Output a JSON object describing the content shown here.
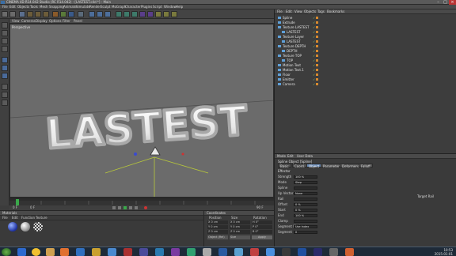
{
  "window": {
    "title": "CINEMA 4D R14.042 Studio (RC R14.042) - [LASTEST.c4d *] - Main",
    "controls": [
      "–",
      "□",
      "×"
    ]
  },
  "menubar": [
    "File",
    "Edit",
    "Objects",
    "Tools",
    "Mesh",
    "Snapping",
    "Animate",
    "Simulate",
    "Render",
    "Sculpt",
    "MoGraph",
    "Character",
    "Plugins",
    "Script",
    "Window",
    "Help"
  ],
  "viewport": {
    "menu": [
      "View",
      "Cameras",
      "Display",
      "Options",
      "Filter",
      "Panel"
    ],
    "label": "Perspective",
    "text3d": "LASTEST"
  },
  "objects": {
    "menu": [
      "File",
      "Edit",
      "View",
      "Objects",
      "Tags",
      "Bookmarks"
    ],
    "rows": [
      {
        "name": "Spline",
        "indent": 0
      },
      {
        "name": "Extrude",
        "indent": 0
      },
      {
        "name": "Texture LASTEST",
        "indent": 0
      },
      {
        "name": "LASTEST",
        "indent": 1
      },
      {
        "name": "Texture Layer",
        "indent": 0
      },
      {
        "name": "LASTEST",
        "indent": 1
      },
      {
        "name": "Texture DEPTH",
        "indent": 0
      },
      {
        "name": "DEPTH",
        "indent": 1
      },
      {
        "name": "Texture TOP",
        "indent": 0
      },
      {
        "name": "TOP",
        "indent": 1
      },
      {
        "name": "Motion Text",
        "indent": 0
      },
      {
        "name": "Motion Text.1",
        "indent": 0
      },
      {
        "name": "Floor",
        "indent": 0
      },
      {
        "name": "Emitter",
        "indent": 0
      },
      {
        "name": "Camera",
        "indent": 0
      }
    ]
  },
  "attributes": {
    "menu": [
      "Mode",
      "Edit",
      "User Data"
    ],
    "object_title": "Spline Object [Spline]",
    "tabs": [
      "Basic",
      "Coord.",
      "Object",
      "Parameter",
      "Deformers",
      "Falloff"
    ],
    "active_tab": "Object",
    "section": "Effector",
    "rows": [
      {
        "key": "Strength",
        "value": "100 %"
      },
      {
        "key": "Mode",
        "value": "Step"
      },
      {
        "key": "Spline",
        "value": ""
      },
      {
        "key": "Up Vector",
        "value": "None"
      },
      {
        "key": "Rail",
        "value": ""
      },
      {
        "key": "Offset",
        "value": "0 %"
      },
      {
        "key": "Start",
        "value": "0 %"
      },
      {
        "key": "End",
        "value": "100 %"
      },
      {
        "key": "Clamp",
        "value": ""
      },
      {
        "key": "Segment Mode",
        "value": "Use Index"
      },
      {
        "key": "Segment",
        "value": "0"
      }
    ],
    "target_rail_label": "Target Rail"
  },
  "materials": {
    "menu": [
      "File",
      "Edit",
      "Function",
      "Texture"
    ],
    "tab": "Materials",
    "swatches": [
      "blue",
      "gray",
      "checker"
    ]
  },
  "coordinates": {
    "tab": "Coordinates",
    "headers": [
      "Position",
      "Size",
      "Rotation"
    ],
    "rows": [
      [
        "X 0 cm",
        "X 0 cm",
        "H 0°"
      ],
      [
        "Y 0 cm",
        "Y 0 cm",
        "P 0°"
      ],
      [
        "Z 0 cm",
        "Z 0 cm",
        "B 0°"
      ]
    ],
    "mode": "Object (Rel)",
    "size_mode": "Size",
    "apply": "Apply"
  },
  "timeline": {
    "start": "0 F",
    "end": "90 F",
    "current": "0 F"
  },
  "taskbar": {
    "time": "10:53",
    "date": "2015-01-01"
  }
}
